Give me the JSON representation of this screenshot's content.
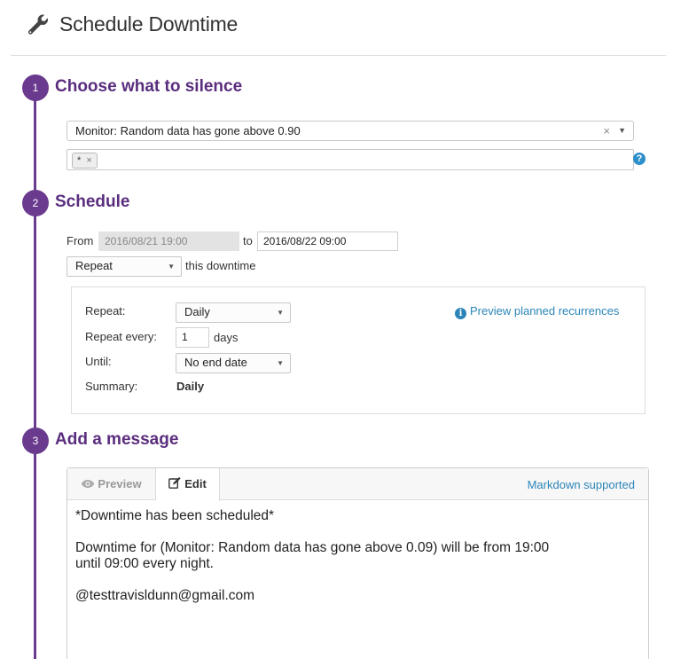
{
  "header": {
    "title": "Schedule Downtime",
    "icon": "wrench-icon"
  },
  "steps": [
    {
      "number": "1",
      "title": "Choose what to silence"
    },
    {
      "number": "2",
      "title": "Schedule"
    },
    {
      "number": "3",
      "title": "Add a message"
    }
  ],
  "silence": {
    "monitor_value": "Monitor: Random data has gone above 0.90",
    "clear_glyph": "×",
    "caret_glyph": "▼",
    "scope_tag": "*",
    "tag_remove": "×",
    "help_glyph": "?"
  },
  "schedule": {
    "from_label": "From",
    "from_value": "2016/08/21 19:00",
    "to_label": "to",
    "to_value": "2016/08/22 09:00",
    "repeat_select": "Repeat",
    "this_downtime": "this downtime",
    "panel": {
      "repeat_label": "Repeat:",
      "repeat_value": "Daily",
      "every_label": "Repeat every:",
      "every_value": "1",
      "every_unit": "days",
      "until_label": "Until:",
      "until_value": "No end date",
      "summary_label": "Summary:",
      "summary_value": "Daily",
      "preview_link": "Preview planned recurrences",
      "info_glyph": "i"
    }
  },
  "message": {
    "tab_preview": "Preview",
    "tab_edit": "Edit",
    "markdown_link": "Markdown supported",
    "lines": [
      "*Downtime has been scheduled*",
      "Downtime for (Monitor: Random data has gone above 0.09) will be from 19:00",
      "until 09:00 every night.",
      "@testtravisldunn@gmail.com"
    ]
  },
  "colors": {
    "accent": "#6a3a8e",
    "title": "#5a2d7e",
    "link": "#2b85b8"
  }
}
